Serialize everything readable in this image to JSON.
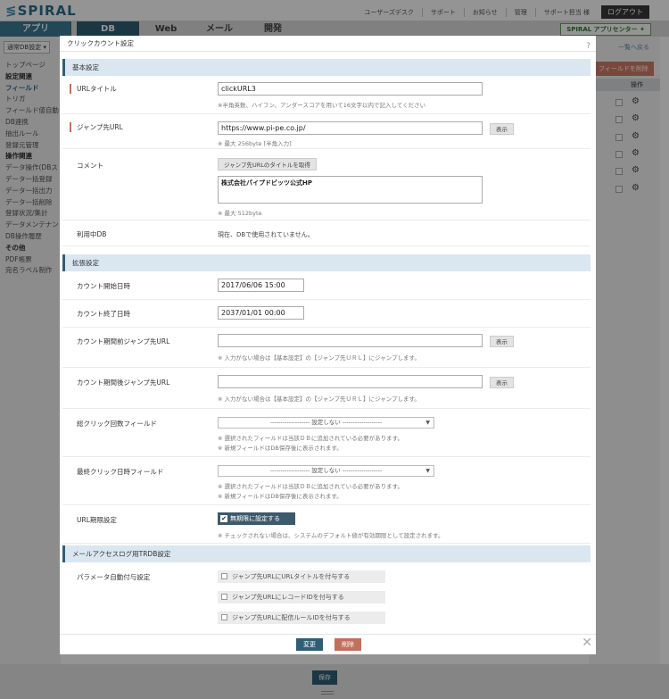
{
  "header": {
    "logo": "SPIRAL",
    "top_links": [
      "ユーザーズデスク",
      "サポート",
      "お知らせ",
      "管理",
      "サポート担当 様"
    ],
    "logout": "ログアウト"
  },
  "tabs": [
    "アプリ",
    "DB",
    "Web",
    "メール",
    "開発"
  ],
  "spiral_app_center": "SPIRAL アプリセンター",
  "sidebar": {
    "db_select": "通常DB設定",
    "items": [
      {
        "label": "トップページ"
      },
      {
        "label": "設定関連",
        "heading": true
      },
      {
        "label": "フィールド",
        "active": true
      },
      {
        "label": "トリガ"
      },
      {
        "label": "フィールド値自動"
      },
      {
        "label": "DB連携"
      },
      {
        "label": "抽出ルール"
      },
      {
        "label": "登録元管理"
      },
      {
        "label": "操作関連",
        "heading": true
      },
      {
        "label": "データ操作(DBス"
      },
      {
        "label": "データ一括登録"
      },
      {
        "label": "データ一括出力"
      },
      {
        "label": "データ一括削除"
      },
      {
        "label": "登録状況/集計"
      },
      {
        "label": "データメンテナン"
      },
      {
        "label": "DB操作履歴"
      },
      {
        "label": "その他",
        "heading": true
      },
      {
        "label": "PDF帳票"
      },
      {
        "label": "宛名ラベル制作"
      }
    ]
  },
  "right_panel": {
    "back_link": "一覧へ戻る",
    "delete_field": "フィールドを削除",
    "operation": "操作"
  },
  "save": "保存",
  "modal": {
    "title": "クリックカウント設定",
    "basic_section": "基本設定",
    "url_title": {
      "label": "URLタイトル",
      "value": "clickURL3",
      "hint": "※半角英数、ハイフン、アンダースコアを用いて16文字以内で記入してください"
    },
    "jump_url": {
      "label": "ジャンプ先URL",
      "value": "https://www.pi-pe.co.jp/",
      "hint": "※ 最大 256byte [半角入力]",
      "show": "表示"
    },
    "comment": {
      "label": "コメント",
      "fetch": "ジャンプ先URLのタイトルを取得",
      "value": "株式会社パイプドビッツ公式HP",
      "hint": "※ 最大 512byte"
    },
    "in_use_db": {
      "label": "利用中DB",
      "value": "現在、DBで使用されていません。"
    },
    "ext_section": "拡張設定",
    "count_start": {
      "label": "カウント開始日時",
      "value": "2017/06/06 15:00"
    },
    "count_end": {
      "label": "カウント終了日時",
      "value": "2037/01/01 00:00"
    },
    "before_url": {
      "label": "カウント期間前ジャンプ先URL",
      "value": "",
      "show": "表示",
      "hint": "※ 入力がない場合は【基本設定】の【ジャンプ先ＵＲＬ】にジャンプします。"
    },
    "after_url": {
      "label": "カウント期間後ジャンプ先URL",
      "value": "",
      "show": "表示",
      "hint": "※ 入力がない場合は【基本設定】の【ジャンプ先ＵＲＬ】にジャンプします。"
    },
    "total_click": {
      "label": "総クリック回数フィールド",
      "value": "------------------- 設定しない -------------------",
      "hint1": "※ 選択されたフィールドは当該ＤＢに追加されている必要があります。",
      "hint2": "※ 新規フィールドはDB保存後に表示されます。"
    },
    "last_click": {
      "label": "最終クリック日時フィールド",
      "value": "------------------- 設定しない -------------------",
      "hint1": "※ 選択されたフィールドは当該ＤＢに追加されている必要があります。",
      "hint2": "※ 新規フィールドはDB保存後に表示されます。"
    },
    "url_expire": {
      "label": "URL期限設定",
      "value": "無期限に設定する",
      "hint": "※ チェックされない場合は、システムのデフォルト値が有効期限として設定されます。"
    },
    "mail_section": "メールアクセスログ用TRDB設定",
    "param": {
      "label": "パラメータ自動付与設定",
      "options": [
        "ジャンプ先URLにURLタイトルを付与する",
        "ジャンプ先URLにレコードIDを付与する",
        "ジャンプ先URLに配信ルールIDを付与する"
      ]
    },
    "change": "変更",
    "delete": "削除"
  },
  "colors": {
    "primary": "#2f5f76",
    "danger": "#c0705c",
    "section_bg": "#dae7f0"
  }
}
